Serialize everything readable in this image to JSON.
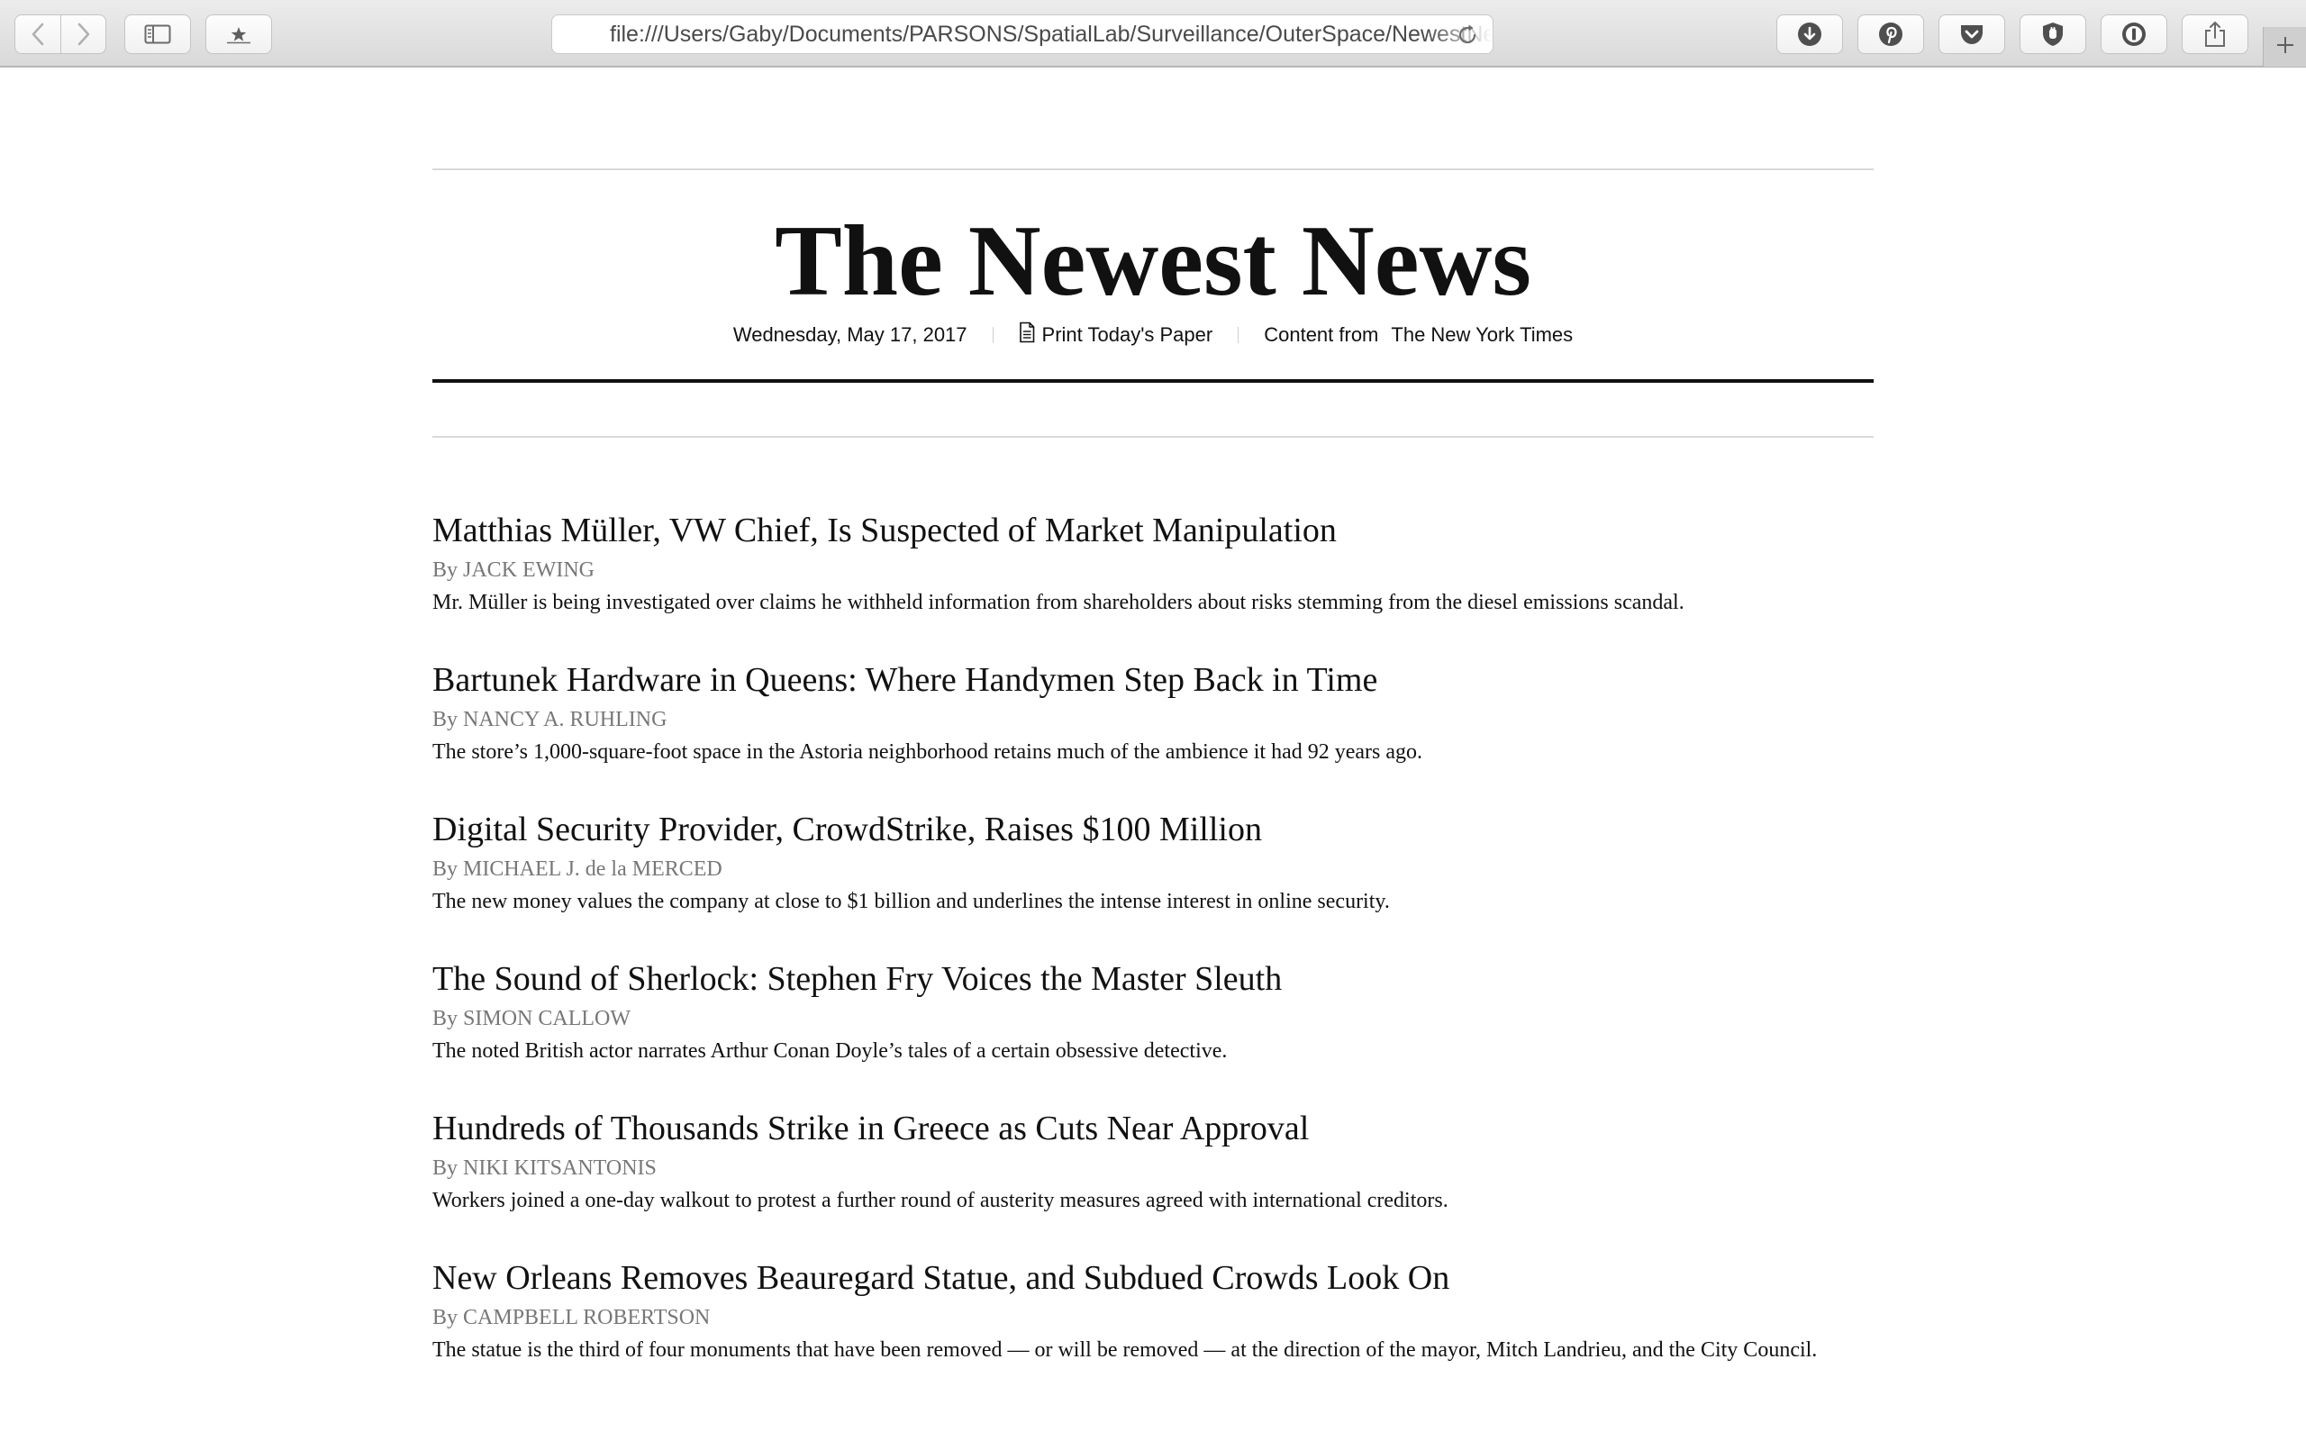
{
  "browser": {
    "url": "file:///Users/Gaby/Documents/PARSONS/SpatialLab/Surveillance/OuterSpace/NewestNews/index.html",
    "icons": {
      "back": "chevron-left-icon",
      "forward": "chevron-right-icon",
      "sidebar": "sidebar-icon",
      "top_sites": "star-icon",
      "reload": "reload-icon",
      "downloads": "download-icon",
      "pinterest": "pinterest-icon",
      "pocket": "pocket-icon",
      "hand": "hand-icon",
      "onepassword": "keyhole-icon",
      "share": "share-icon",
      "new_tab": "plus-icon"
    }
  },
  "masthead": {
    "title": "The Newest News",
    "date": "Wednesday, May 17, 2017",
    "print_label": "Print Today's Paper",
    "content_from": "Content from",
    "source": "The New York Times"
  },
  "articles": [
    {
      "headline": "Matthias Müller, VW Chief, Is Suspected of Market Manipulation",
      "byline": "By JACK EWING",
      "summary": "Mr. Müller is being investigated over claims he withheld information from shareholders about risks stemming from the diesel emissions scandal."
    },
    {
      "headline": "Bartunek Hardware in Queens: Where Handymen Step Back in Time",
      "byline": "By NANCY A. RUHLING",
      "summary": "The store’s 1,000-square-foot space in the Astoria neighborhood retains much of the ambience it had 92 years ago."
    },
    {
      "headline": "Digital Security Provider, CrowdStrike, Raises $100 Million",
      "byline": "By MICHAEL J. de la MERCED",
      "summary": "The new money values the company at close to $1 billion and underlines the intense interest in online security."
    },
    {
      "headline": "The Sound of Sherlock: Stephen Fry Voices the Master Sleuth",
      "byline": "By SIMON CALLOW",
      "summary": "The noted British actor narrates Arthur Conan Doyle’s tales of a certain obsessive detective."
    },
    {
      "headline": "Hundreds of Thousands Strike in Greece as Cuts Near Approval",
      "byline": "By NIKI KITSANTONIS",
      "summary": "Workers joined a one-day walkout to protest a further round of austerity measures agreed with international creditors."
    },
    {
      "headline": "New Orleans Removes Beauregard Statue, and Subdued Crowds Look On",
      "byline": "By CAMPBELL ROBERTSON",
      "summary": "The statue is the third of four monuments that have been removed — or will be removed — at the direction of the mayor, Mitch Landrieu, and the City Council."
    }
  ]
}
